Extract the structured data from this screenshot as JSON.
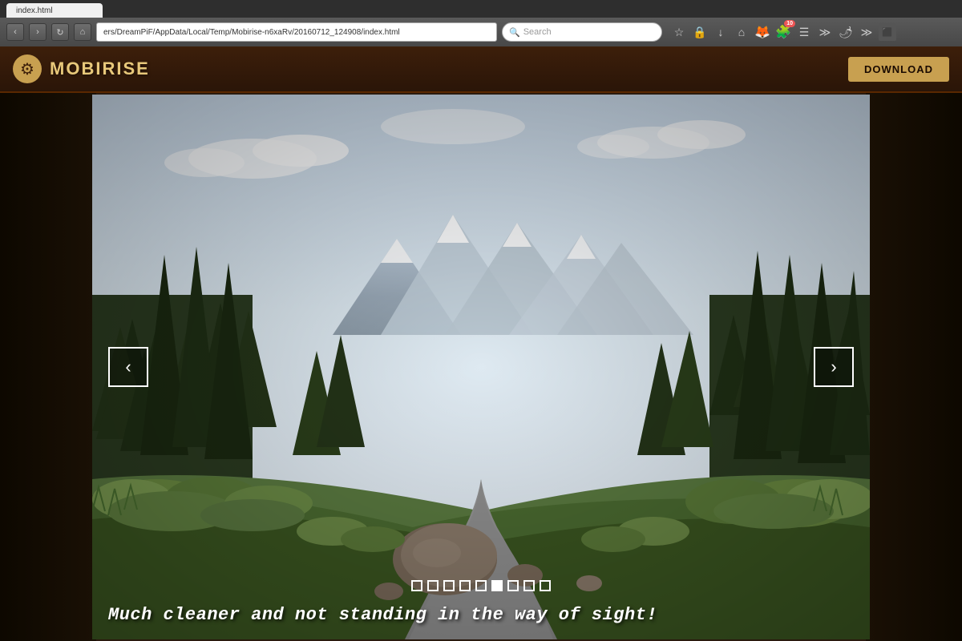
{
  "browser": {
    "address": "ers/DreamPiF/AppData/Local/Temp/Mobirise-n6xaRv/20160712_124908/index.html",
    "search_placeholder": "Search",
    "tab_label": "index.html",
    "reload_icon": "↻",
    "back_icon": "‹",
    "forward_icon": "›",
    "home_icon": "⌂",
    "bookmark_icon": "☆",
    "download_icon": "↓",
    "lock_icon": "🔒",
    "extensions_badge": "10"
  },
  "app": {
    "logo_icon": "⚙",
    "title": "MOBIRISE",
    "download_button": "DOWNLOAD",
    "colors": {
      "topbar_bg": "#3d1f0a",
      "accent": "#c8a050",
      "dark_bg": "#0d0800"
    }
  },
  "carousel": {
    "caption": "Much cleaner and not standing in the way of sight!",
    "prev_label": "‹",
    "next_label": "›",
    "dots": [
      {
        "active": false
      },
      {
        "active": false
      },
      {
        "active": false
      },
      {
        "active": false
      },
      {
        "active": false
      },
      {
        "active": true
      },
      {
        "active": false
      },
      {
        "active": false
      },
      {
        "active": false
      }
    ]
  }
}
